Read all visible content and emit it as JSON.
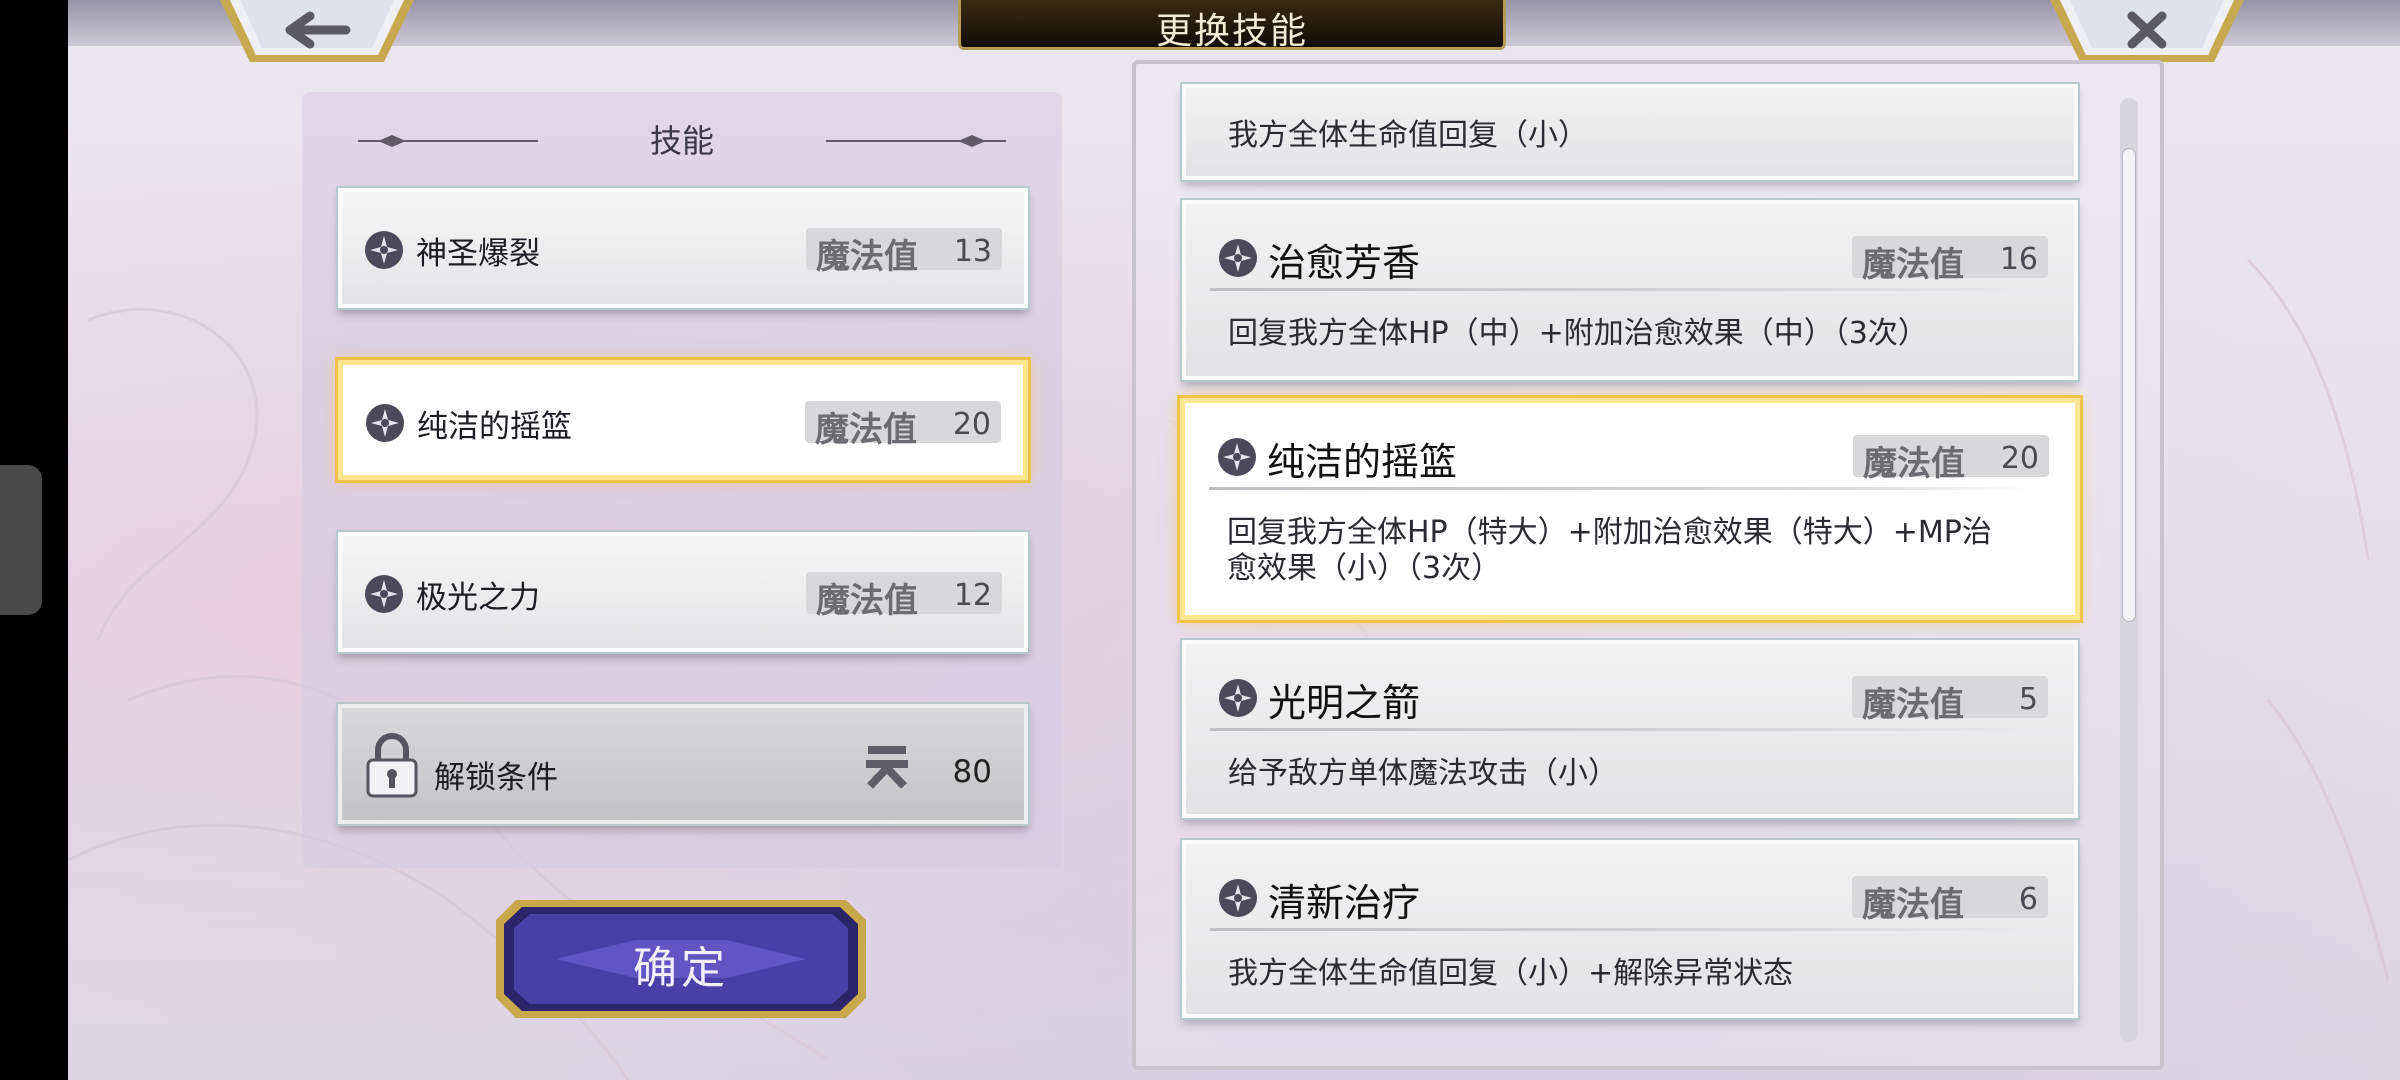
{
  "header": {
    "title": "更换技能"
  },
  "left_panel": {
    "heading": "技能",
    "slots": [
      {
        "name": "神圣爆裂",
        "mp_label": "魔法值",
        "mp": "13"
      },
      {
        "name": "纯洁的摇篮",
        "mp_label": "魔法值",
        "mp": "20"
      },
      {
        "name": "极光之力",
        "mp_label": "魔法值",
        "mp": "12"
      }
    ],
    "locked_slot": {
      "label": "解锁条件",
      "value": "80"
    },
    "confirm_label": "确定"
  },
  "skill_list": [
    {
      "name": "",
      "mp_label": "",
      "mp": "",
      "desc": "我方全体生命值回复（小）"
    },
    {
      "name": "治愈芳香",
      "mp_label": "魔法值",
      "mp": "16",
      "desc": "回复我方全体HP（中）+附加治愈效果（中）（3次）"
    },
    {
      "name": "纯洁的摇篮",
      "mp_label": "魔法值",
      "mp": "20",
      "desc": "回复我方全体HP（特大）+附加治愈效果（特大）+MP治愈效果（小）（3次）"
    },
    {
      "name": "光明之箭",
      "mp_label": "魔法值",
      "mp": "5",
      "desc": "给予敌方单体魔法攻击（小）"
    },
    {
      "name": "清新治疗",
      "mp_label": "魔法值",
      "mp": "6",
      "desc": "我方全体生命值回复（小）+解除异常状态"
    }
  ],
  "icons": {
    "back": "back-arrow-icon",
    "close": "close-icon",
    "skill": "skill-emblem-icon",
    "lock": "padlock-icon",
    "condition": "sky-glyph-icon"
  },
  "colors": {
    "selected_border": "#f1c54c",
    "title_plate": "#120c05",
    "confirm_button": "#3d3590"
  }
}
